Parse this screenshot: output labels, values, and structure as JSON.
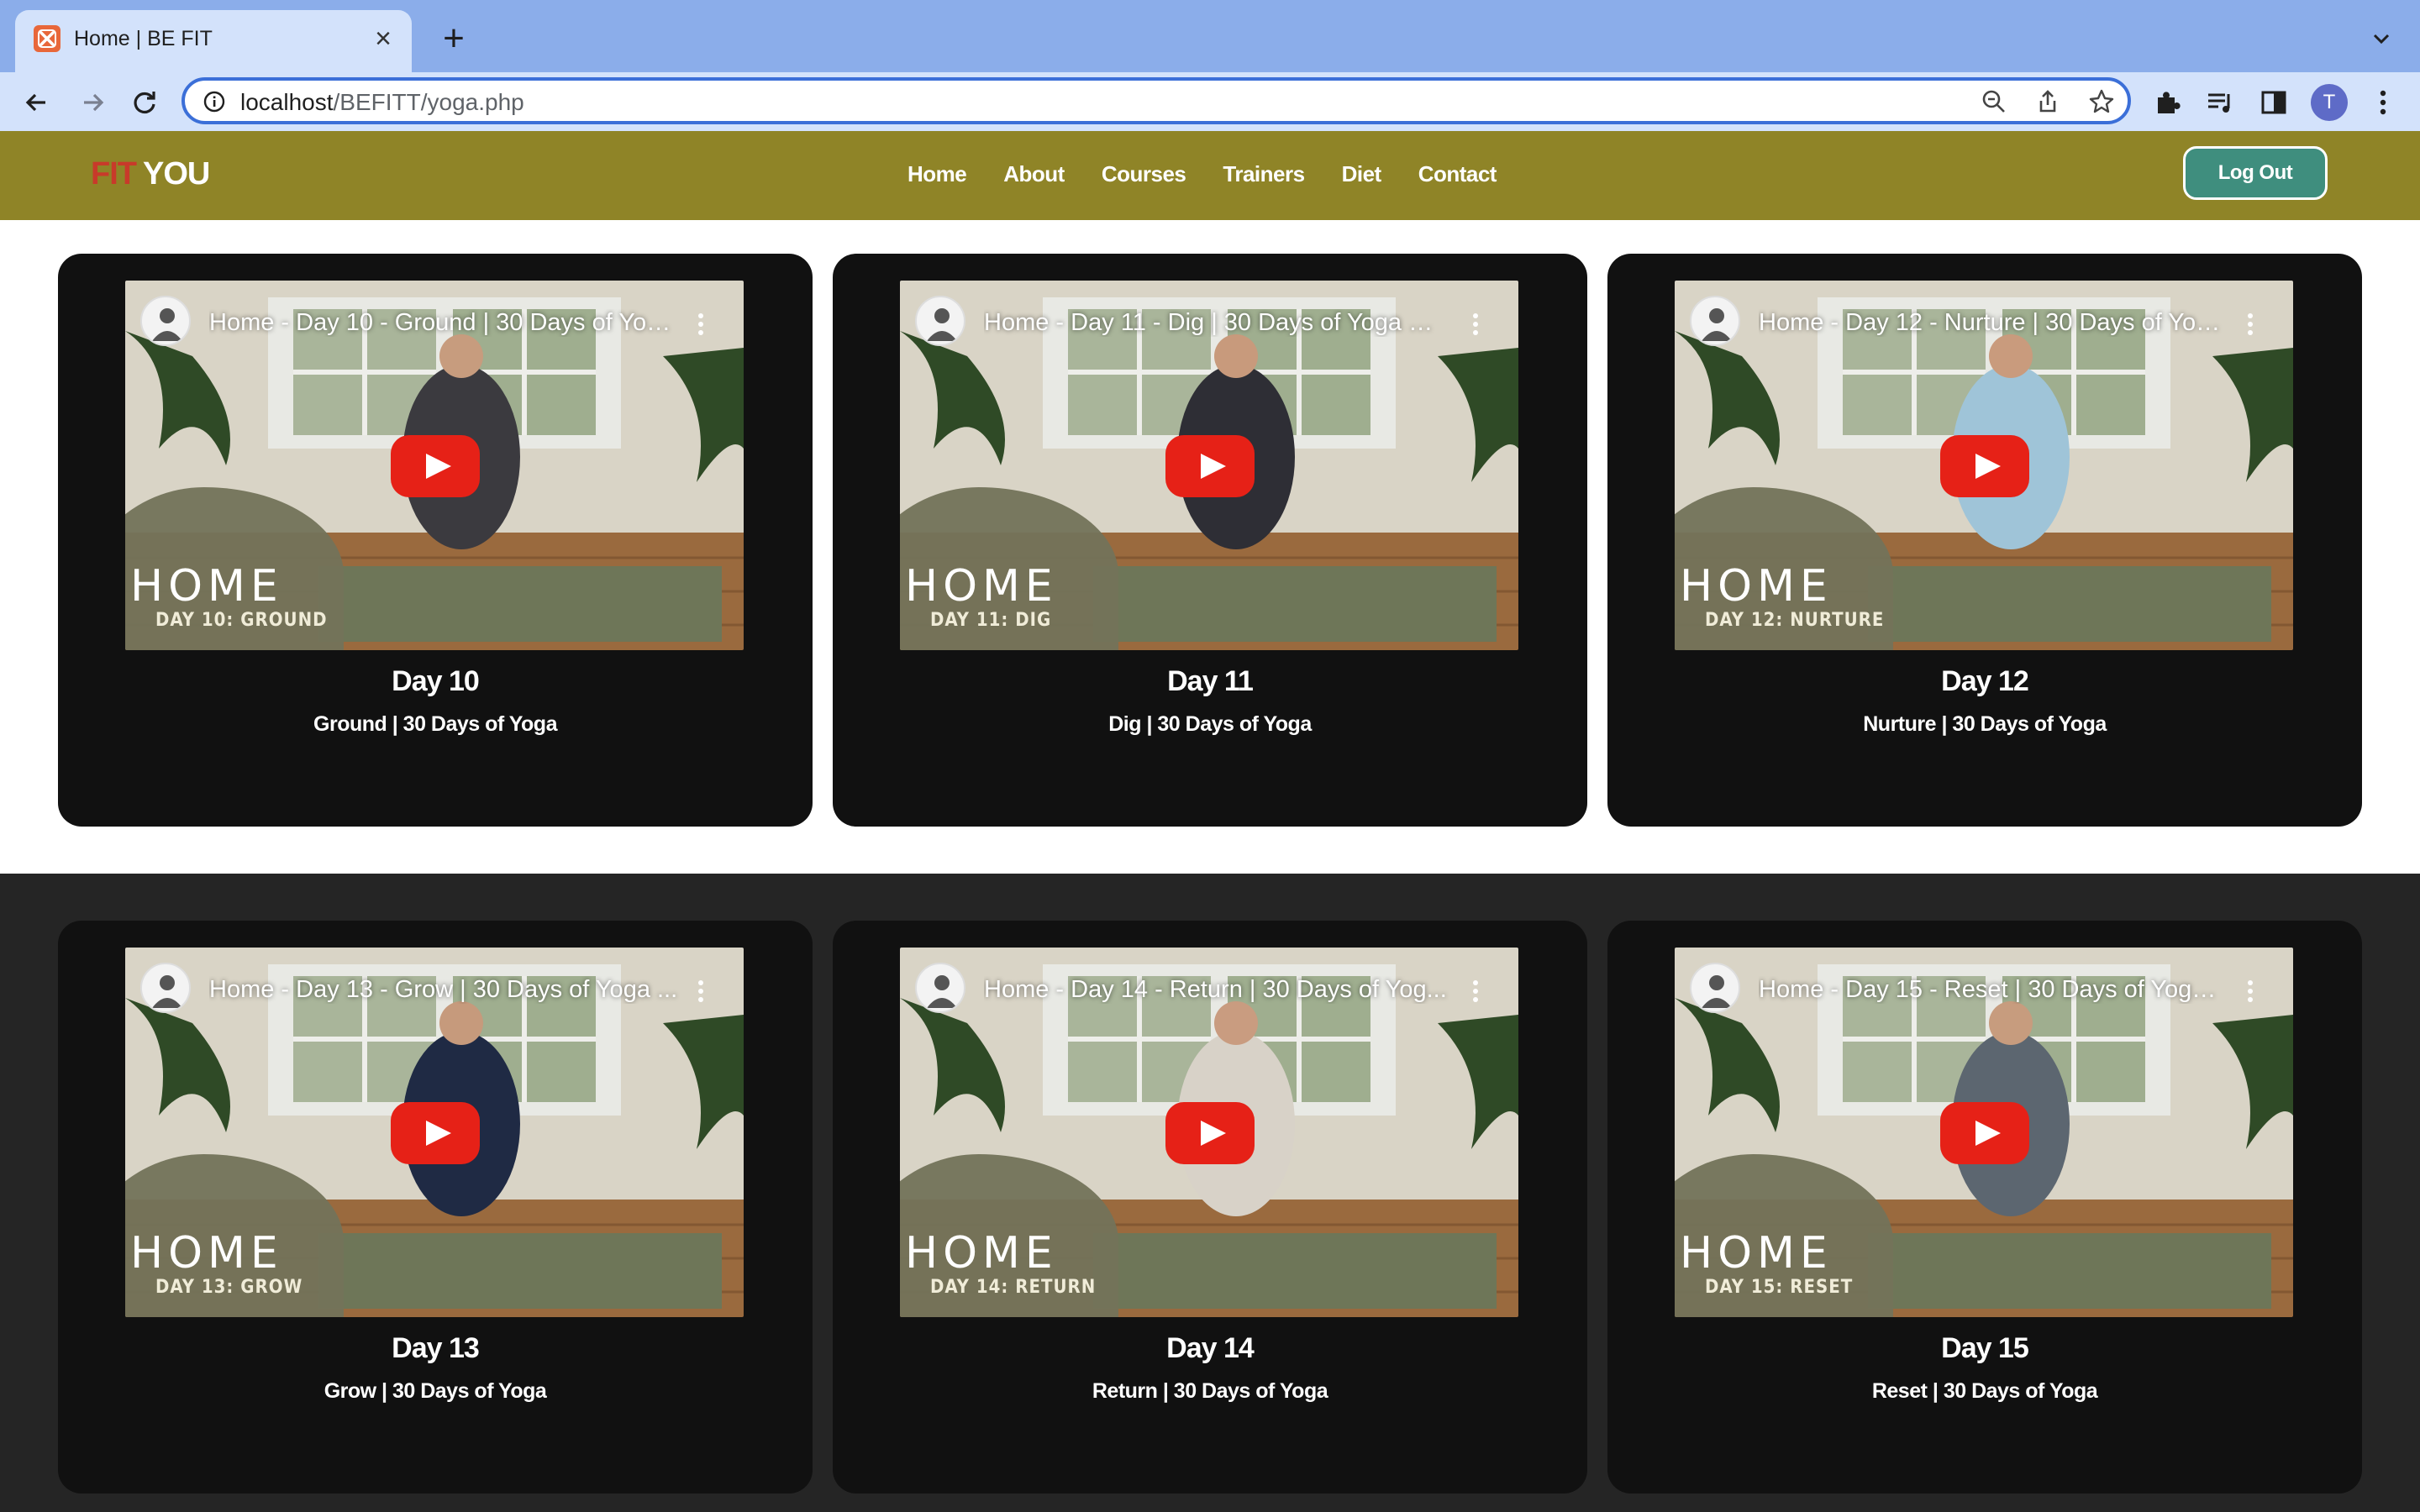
{
  "browser": {
    "tab_title": "Home | BE FIT",
    "url_host": "localhost",
    "url_path": "/BEFITT/yoga.php",
    "profile_initial": "T"
  },
  "site": {
    "logo_fit": "FIT",
    "logo_you": "YOU",
    "nav": [
      "Home",
      "About",
      "Courses",
      "Trainers",
      "Diet",
      "Contact"
    ],
    "logout_label": "Log Out"
  },
  "colors": {
    "header_bg": "#8f8427",
    "card_bg": "#111111",
    "dark_section_bg": "#252525",
    "logout_bg": "#3f8e7e",
    "play_red": "#e62117"
  },
  "cards": [
    {
      "video_title": "Home - Day 10 - Ground | 30 Days of Yog...",
      "overlay_home": "HOME",
      "overlay_day": "DAY 10: GROUND",
      "title": "Day 10",
      "subtitle": "Ground | 30 Days of Yoga"
    },
    {
      "video_title": "Home - Day 11 - Dig | 30 Days of Yoga Wi...",
      "overlay_home": "HOME",
      "overlay_day": "DAY 11: DIG",
      "title": "Day 11",
      "subtitle": "Dig | 30 Days of Yoga"
    },
    {
      "video_title": "Home - Day 12 - Nurture | 30 Days of Yog...",
      "overlay_home": "HOME",
      "overlay_day": "DAY 12: NURTURE",
      "title": "Day 12",
      "subtitle": "Nurture | 30 Days of Yoga"
    },
    {
      "video_title": "Home - Day 13 - Grow | 30 Days of Yoga ...",
      "overlay_home": "HOME",
      "overlay_day": "DAY 13: GROW",
      "title": "Day 13",
      "subtitle": "Grow | 30 Days of Yoga"
    },
    {
      "video_title": "Home - Day 14 - Return | 30 Days of Yog...",
      "overlay_home": "HOME",
      "overlay_day": "DAY 14: RETURN",
      "title": "Day 14",
      "subtitle": "Return | 30 Days of Yoga"
    },
    {
      "video_title": "Home - Day 15 - Reset | 30 Days of Yoga ...",
      "overlay_home": "HOME",
      "overlay_day": "DAY 15: RESET",
      "title": "Day 15",
      "subtitle": "Reset | 30 Days of Yoga"
    }
  ]
}
